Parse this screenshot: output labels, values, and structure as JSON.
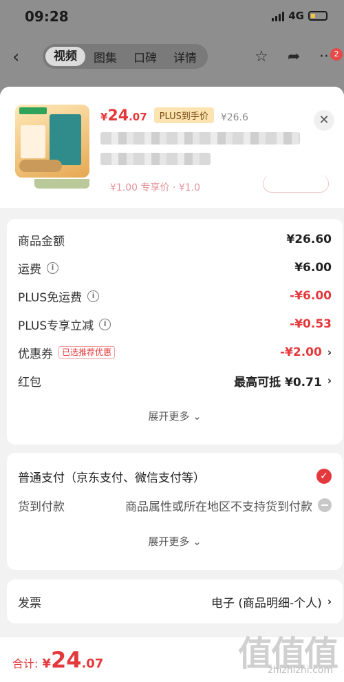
{
  "status_bar": {
    "time": "09:28",
    "network": "4G"
  },
  "nav": {
    "tabs": [
      "视频",
      "图集",
      "口碑",
      "详情"
    ],
    "badge_count": "2",
    "icons": [
      "back-arrow-icon",
      "star-icon",
      "share-icon",
      "more-icon"
    ]
  },
  "product": {
    "price_currency": "¥",
    "price_int": "24",
    "price_dec": ".07",
    "plus_tag": "PLUS到手价",
    "original_price": "¥26.6"
  },
  "peek": {
    "price": "¥1.00 专享价 · ¥1.0"
  },
  "fees": {
    "goods_amount": {
      "label": "商品金额",
      "value": "¥26.60"
    },
    "shipping": {
      "label": "运费",
      "value": "¥6.00"
    },
    "plus_free_shipping": {
      "label": "PLUS免运费",
      "value": "-¥6.00"
    },
    "plus_discount": {
      "label": "PLUS专享立减",
      "value": "-¥0.53"
    },
    "coupon": {
      "label": "优惠券",
      "tag": "已选推荐优惠",
      "value": "-¥2.00"
    },
    "red_packet": {
      "label": "红包",
      "value": "最高可抵 ¥0.71"
    },
    "expand_more": "展开更多"
  },
  "payment": {
    "normal": {
      "label": "普通支付（京东支付、微信支付等）",
      "selected": true
    },
    "cod": {
      "label": "货到付款",
      "note": "商品属性或所在地区不支持货到付款"
    },
    "expand_more": "展开更多"
  },
  "invoice": {
    "label": "发票",
    "value": "电子 (商品明细-个人)"
  },
  "total": {
    "label": "合计:",
    "currency": "¥",
    "int": "24",
    "dec": ".07"
  },
  "watermark": {
    "glyphs": "值值值",
    "site": "zhizhizhi.com"
  },
  "colors": {
    "accent": "#e4393c",
    "plus_gold": "#fbe4b2"
  }
}
